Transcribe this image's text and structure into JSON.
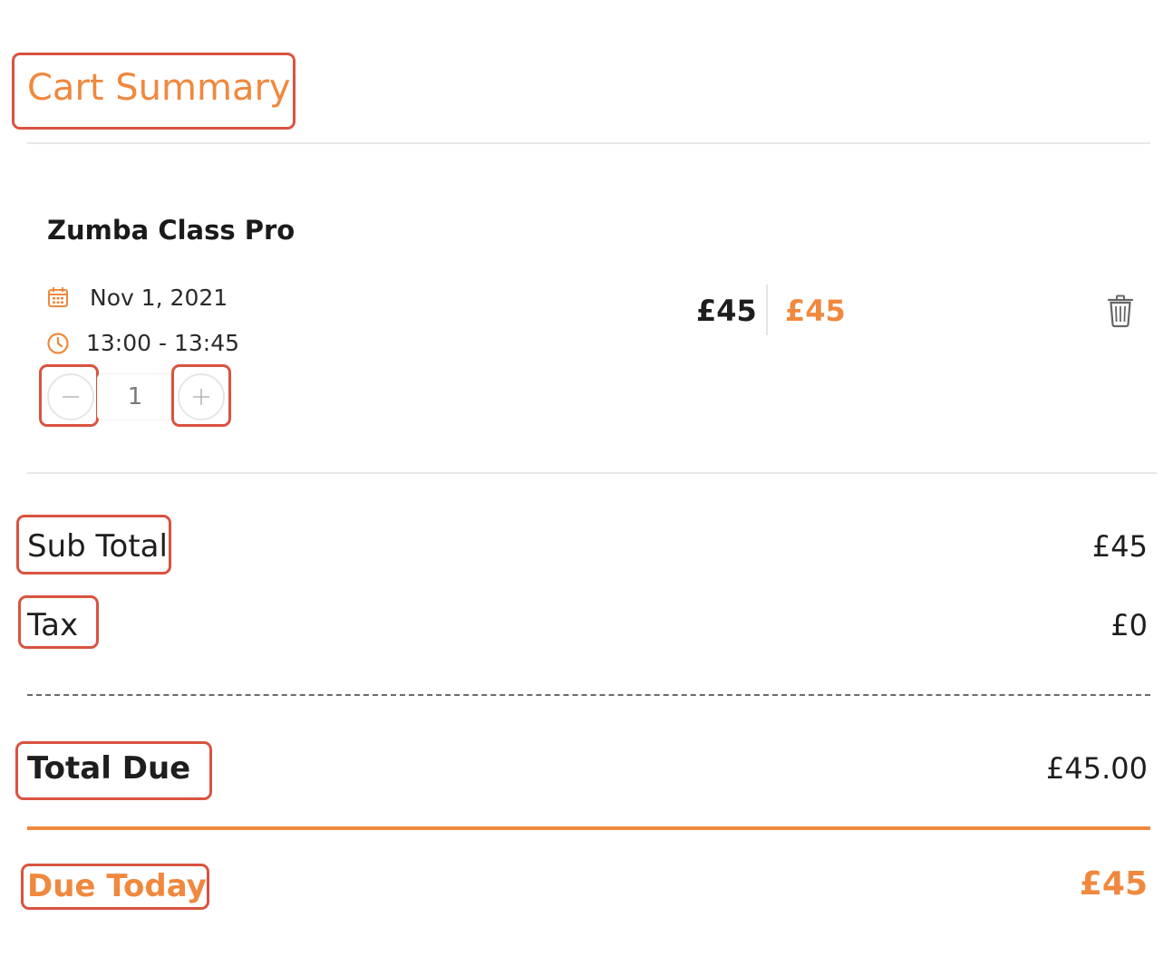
{
  "cart": {
    "title": "Cart Summary",
    "item": {
      "name": "Zumba Class Pro",
      "date": "Nov 1, 2021",
      "time": "13:00 - 13:45",
      "quantity": "1",
      "original_price": "£45",
      "final_price": "£45"
    },
    "icons": {
      "date": "calendar-icon",
      "time": "clock-icon",
      "delete": "trash-icon",
      "decrease": "minus-icon",
      "increase": "plus-icon"
    }
  },
  "summary": {
    "subtotal_label": "Sub Total",
    "subtotal_value": "£45",
    "tax_label": "Tax",
    "tax_value": "£0",
    "total_label": "Total Due",
    "total_value": "£45.00",
    "due_today_label": "Due Today",
    "due_today_value": "£45"
  },
  "colors": {
    "accent": "#f0883e",
    "annotation": "#d9533f",
    "divider": "#e7e7ea"
  }
}
